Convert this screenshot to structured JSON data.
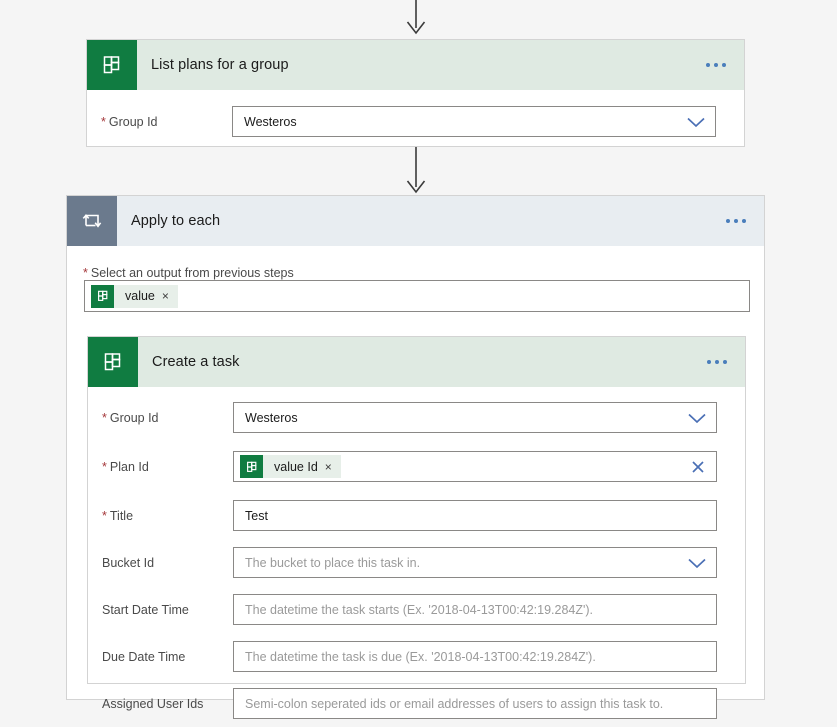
{
  "colors": {
    "canvas_bg": "#f5f5f5",
    "card_bg": "#ffffff",
    "planner_green": "#107c41",
    "planner_header_green": "#dfeae2",
    "loop_slate": "#6b7a8d",
    "loop_header": "#e8edf1",
    "accent_blue": "#4a7ebb",
    "required_red": "#a4373a",
    "token_bg": "#e7efe9",
    "border": "#8a8886",
    "arrow": "#3b3b3b"
  },
  "steps": {
    "list_plans": {
      "title": "List plans for a group",
      "icon": "planner-icon",
      "overflow_menu": "more-commands-icon",
      "fields": [
        {
          "label": "Group Id",
          "required": true,
          "value": "Westeros",
          "placeholder": "",
          "control": "dropdown"
        }
      ]
    },
    "apply_to_each": {
      "title": "Apply to each",
      "icon": "loop-icon",
      "overflow_menu": "more-commands-icon",
      "select_label": "Select an output from previous steps",
      "select_required": true,
      "token": {
        "label": "value",
        "icon": "planner-icon",
        "remove": "×"
      }
    },
    "create_task": {
      "title": "Create a task",
      "icon": "planner-icon",
      "overflow_menu": "more-commands-icon",
      "fields": [
        {
          "label": "Group Id",
          "required": true,
          "value": "Westeros",
          "placeholder": "",
          "control": "dropdown"
        },
        {
          "label": "Plan Id",
          "required": true,
          "value": "",
          "placeholder": "",
          "control": "token",
          "token": {
            "label": "value Id",
            "icon": "planner-icon",
            "remove": "×"
          },
          "clear": "clear-icon"
        },
        {
          "label": "Title",
          "required": true,
          "value": "Test",
          "placeholder": "",
          "control": "text"
        },
        {
          "label": "Bucket Id",
          "required": false,
          "value": "",
          "placeholder": "The bucket to place this task in.",
          "control": "dropdown"
        },
        {
          "label": "Start Date Time",
          "required": false,
          "value": "",
          "placeholder": "The datetime the task starts (Ex. '2018-04-13T00:42:19.284Z').",
          "control": "text"
        },
        {
          "label": "Due Date Time",
          "required": false,
          "value": "",
          "placeholder": "The datetime the task is due (Ex. '2018-04-13T00:42:19.284Z').",
          "control": "text"
        },
        {
          "label": "Assigned User Ids",
          "required": false,
          "value": "",
          "placeholder": "Semi-colon seperated ids or email addresses of users to assign this task to.",
          "control": "text"
        }
      ]
    }
  }
}
